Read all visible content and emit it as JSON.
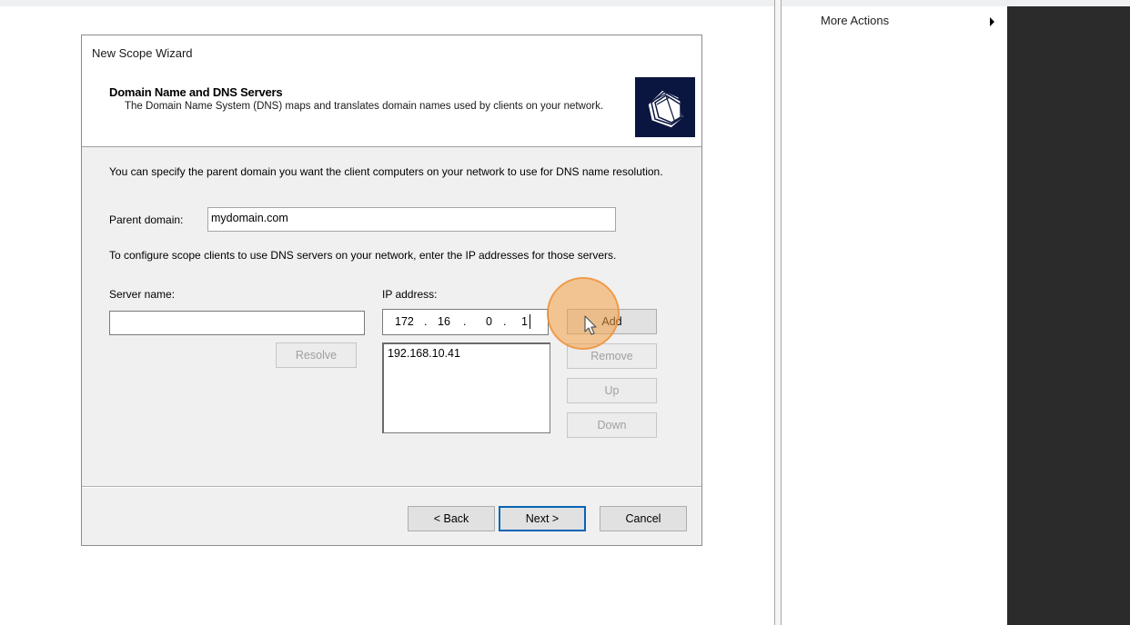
{
  "actions_pane": {
    "more_actions_label": "More Actions"
  },
  "wizard": {
    "window_title": "New Scope Wizard",
    "page_title": "Domain Name and DNS Servers",
    "page_description": "The Domain Name System (DNS) maps and translates domain names used by clients on your network.",
    "intro_text": "You can specify the parent domain you want the client computers on your network to use for DNS name resolution.",
    "parent_domain_label": "Parent domain:",
    "parent_domain_value": "mydomain.com",
    "dns_instructions": "To configure scope clients to use DNS servers on your network, enter the IP addresses for those servers.",
    "server_name_label": "Server name:",
    "server_name_value": "",
    "ip_address_label": "IP address:",
    "ip_octets": [
      "172",
      "16",
      "0",
      "1"
    ],
    "ip_dots": [
      ".",
      ".",
      "."
    ],
    "ip_list": [
      "192.168.10.41"
    ],
    "buttons": {
      "resolve": "Resolve",
      "add": "Add",
      "remove": "Remove",
      "up": "Up",
      "down": "Down",
      "back": "< Back",
      "next": "Next >",
      "cancel": "Cancel"
    },
    "icon": "wizard-folders-icon"
  },
  "colors": {
    "dialog_background": "#f0f0f0",
    "header_background": "#ffffff",
    "default_button_border": "#0a64b4",
    "click_highlight": "#f4a046",
    "right_pane_background": "#2b2b2b"
  }
}
